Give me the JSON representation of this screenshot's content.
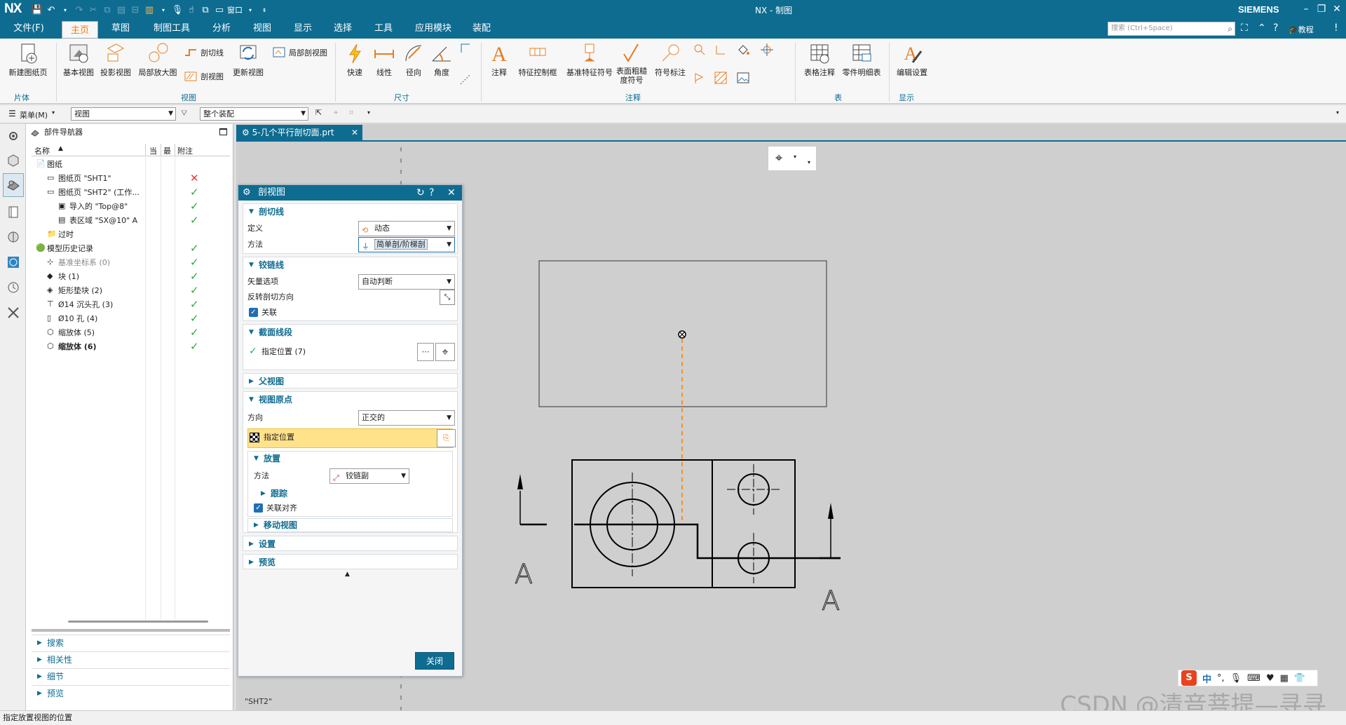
{
  "app": {
    "logo": "NX",
    "title": "NX - 制图",
    "brand": "SIEMENS",
    "window_menu": "窗口"
  },
  "menu": {
    "items": [
      "文件(F)",
      "主页",
      "草图",
      "制图工具",
      "分析",
      "视图",
      "显示",
      "选择",
      "工具",
      "应用模块",
      "装配"
    ],
    "active": "主页",
    "search_placeholder": "搜索 (Ctrl+Space)",
    "tutorial": "教程"
  },
  "ribbon": {
    "buttons": {
      "new_sheet": "新建图纸页",
      "base_view": "基本视图",
      "proj_view": "投影视图",
      "detail_view": "局部放大图",
      "section_line": "剖切线",
      "section_view": "剖视图",
      "update_view": "更新视图",
      "break_view": "局部剖视图",
      "rapid": "快速",
      "linear": "线性",
      "radial": "径向",
      "angular": "角度",
      "note": "注释",
      "fcf": "特征控制框",
      "datum_symbol": "基准特征符号",
      "surface_finish": "表面粗糙度符号",
      "id_symbol": "符号标注",
      "table_note": "表格注释",
      "parts_list": "零件明细表",
      "edit_settings": "编辑设置"
    },
    "groups": [
      "片体",
      "视图",
      "尺寸",
      "注释",
      "表",
      "显示"
    ]
  },
  "toolbar2": {
    "menu_label": "菜单(M)",
    "filter_view": "视图",
    "filter_scope": "整个装配"
  },
  "navigator": {
    "title": "部件导航器",
    "columns": [
      "名称",
      "当",
      "最",
      "附注"
    ],
    "rows": [
      {
        "label": "图纸",
        "indent": 0,
        "mark": ""
      },
      {
        "label": "图纸页 \"SHT1\"",
        "indent": 1,
        "mark": "x"
      },
      {
        "label": "图纸页 \"SHT2\" (工作...",
        "indent": 1,
        "mark": "ok"
      },
      {
        "label": "导入的 \"Top@8\"",
        "indent": 2,
        "mark": "ok"
      },
      {
        "label": "表区域 \"SX@10\" A",
        "indent": 2,
        "mark": "ok"
      },
      {
        "label": "过时",
        "indent": 1,
        "mark": ""
      },
      {
        "label": "模型历史记录",
        "indent": 0,
        "mark": "ok"
      },
      {
        "label": "基准坐标系 (0)",
        "indent": 1,
        "mark": "ok"
      },
      {
        "label": "块 (1)",
        "indent": 1,
        "mark": "ok"
      },
      {
        "label": "矩形垫块 (2)",
        "indent": 1,
        "mark": "ok"
      },
      {
        "label": "Ø14 沉头孔 (3)",
        "indent": 1,
        "mark": "ok"
      },
      {
        "label": "Ø10 孔 (4)",
        "indent": 1,
        "mark": "ok"
      },
      {
        "label": "缩放体 (5)",
        "indent": 1,
        "mark": "ok"
      },
      {
        "label": "缩放体 (6)",
        "indent": 1,
        "mark": "ok"
      }
    ],
    "panels": [
      "搜索",
      "相关性",
      "细节",
      "预览"
    ]
  },
  "document": {
    "tab": "5-几个平行剖切面.prt",
    "sheet": "\"SHT2\""
  },
  "dialog": {
    "title": "剖视图",
    "sec_cutline": "剖切线",
    "define_label": "定义",
    "define_value": "动态",
    "method_label": "方法",
    "method_value": "简单剖/阶梯剖",
    "sec_hinge": "铰链线",
    "vector_label": "矢量选项",
    "vector_value": "自动判断",
    "reverse_label": "反转剖切方向",
    "assoc_label": "关联",
    "sec_segments": "截面线段",
    "spec_loc_count": "指定位置 (7)",
    "sec_parent": "父视图",
    "sec_origin": "视图原点",
    "orient_label": "方向",
    "orient_value": "正交的",
    "spec_loc": "指定位置",
    "sec_place": "放置",
    "place_method_label": "方法",
    "place_method_value": "铰链副",
    "track": "跟踪",
    "assoc_align": "关联对齐",
    "move_view": "移动视图",
    "settings": "设置",
    "preview": "预览",
    "close": "关闭"
  },
  "drawing": {
    "label_a": "A"
  },
  "status": "指定放置视图的位置",
  "ime": {
    "logo": "S",
    "lang": "中"
  },
  "watermark": "CSDN @清音菩提—寻寻"
}
